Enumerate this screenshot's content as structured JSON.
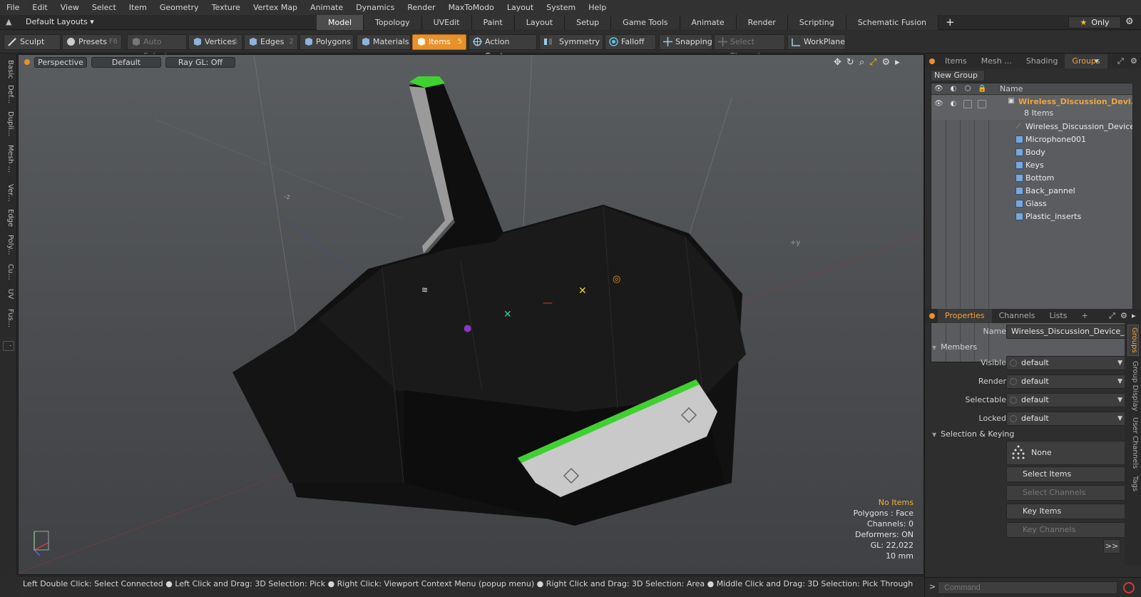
{
  "menu": [
    "File",
    "Edit",
    "View",
    "Select",
    "Item",
    "Geometry",
    "Texture",
    "Vertex Map",
    "Animate",
    "Dynamics",
    "Render",
    "MaxToModo",
    "Layout",
    "System",
    "Help"
  ],
  "layout_bar": {
    "layout_select": "Default Layouts ▾",
    "tabs": [
      "Model",
      "Topology",
      "UVEdit",
      "Paint",
      "Layout",
      "Setup",
      "Game Tools",
      "Animate",
      "Render",
      "Scripting",
      "Schematic Fusion"
    ],
    "active_tab": "Model",
    "only_label": "Only"
  },
  "toolbar": {
    "sculpt": "Sculpt",
    "presets": "Presets",
    "presets_key": "F6",
    "auto_select": "Auto Select",
    "vertices": "Vertices",
    "vertices_key": "1",
    "edges": "Edges",
    "edges_key": "2",
    "polygons": "Polygons",
    "materials": "Materials",
    "items": "Items",
    "items_key": "5",
    "action_center": "Action Center",
    "symmetry": "Symmetry",
    "falloff": "Falloff",
    "snapping": "Snapping",
    "select_through": "Select Through",
    "workplane": "WorkPlane"
  },
  "left_tabs": [
    "Basic",
    "Def...",
    "Dupli...",
    "Mesh ...",
    "Ver...",
    "Edge",
    "Poly...",
    "Cu...",
    "UV",
    "Fus..."
  ],
  "viewport": {
    "view": "Perspective",
    "shading": "Default",
    "raygl": "Ray GL: Off",
    "info": {
      "selection": "No Items",
      "polygons": "Polygons : Face",
      "channels": "Channels: 0",
      "deformers": "Deformers: ON",
      "gl": "GL: 22,022",
      "scale": "10 mm"
    },
    "axis_labels": {
      "neg_z": "-z",
      "pos_y": "+y"
    }
  },
  "statusbar": "Left Double Click: Select Connected ● Left Click and Drag: 3D Selection: Pick ● Right Click: Viewport Context Menu (popup menu) ● Right Click and Drag: 3D Selection: Area ● Middle Click and Drag: 3D Selection: Pick Through",
  "right_panel": {
    "tabs": [
      "Items",
      "Mesh ...",
      "Shading",
      "Groups"
    ],
    "active_tab": "Groups",
    "new_group": "New Group",
    "column_name": "Name",
    "group": {
      "name": "Wireless_Discussion_Devi...",
      "count": "8 Items",
      "children": [
        "Wireless_Discussion_Device ...",
        "Microphone001",
        "Body",
        "Keys",
        "Bottom",
        "Back_pannel",
        "Glass",
        "Plastic_inserts"
      ]
    },
    "prop_tabs": [
      "Properties",
      "Channels",
      "Lists"
    ],
    "active_prop_tab": "Properties",
    "properties": {
      "name_label": "Name",
      "name_value": "Wireless_Discussion_Device_with",
      "members_section": "Members",
      "visible_label": "Visible",
      "visible_value": "default",
      "render_label": "Render",
      "render_value": "default",
      "selectable_label": "Selectable",
      "selectable_value": "default",
      "locked_label": "Locked",
      "locked_value": "default",
      "keying_section": "Selection & Keying",
      "none_btn": "None",
      "select_items": "Select Items",
      "select_channels": "Select Channels",
      "key_items": "Key Items",
      "key_channels": "Key Channels",
      "more": ">>"
    },
    "side_tabs": [
      "Groups",
      "Group Display",
      "User Channels",
      "Tags"
    ],
    "command_placeholder": "Command"
  },
  "colors": {
    "accent": "#e8902a",
    "highlight": "#f2a53a",
    "green_trim": "#3fd12f"
  }
}
